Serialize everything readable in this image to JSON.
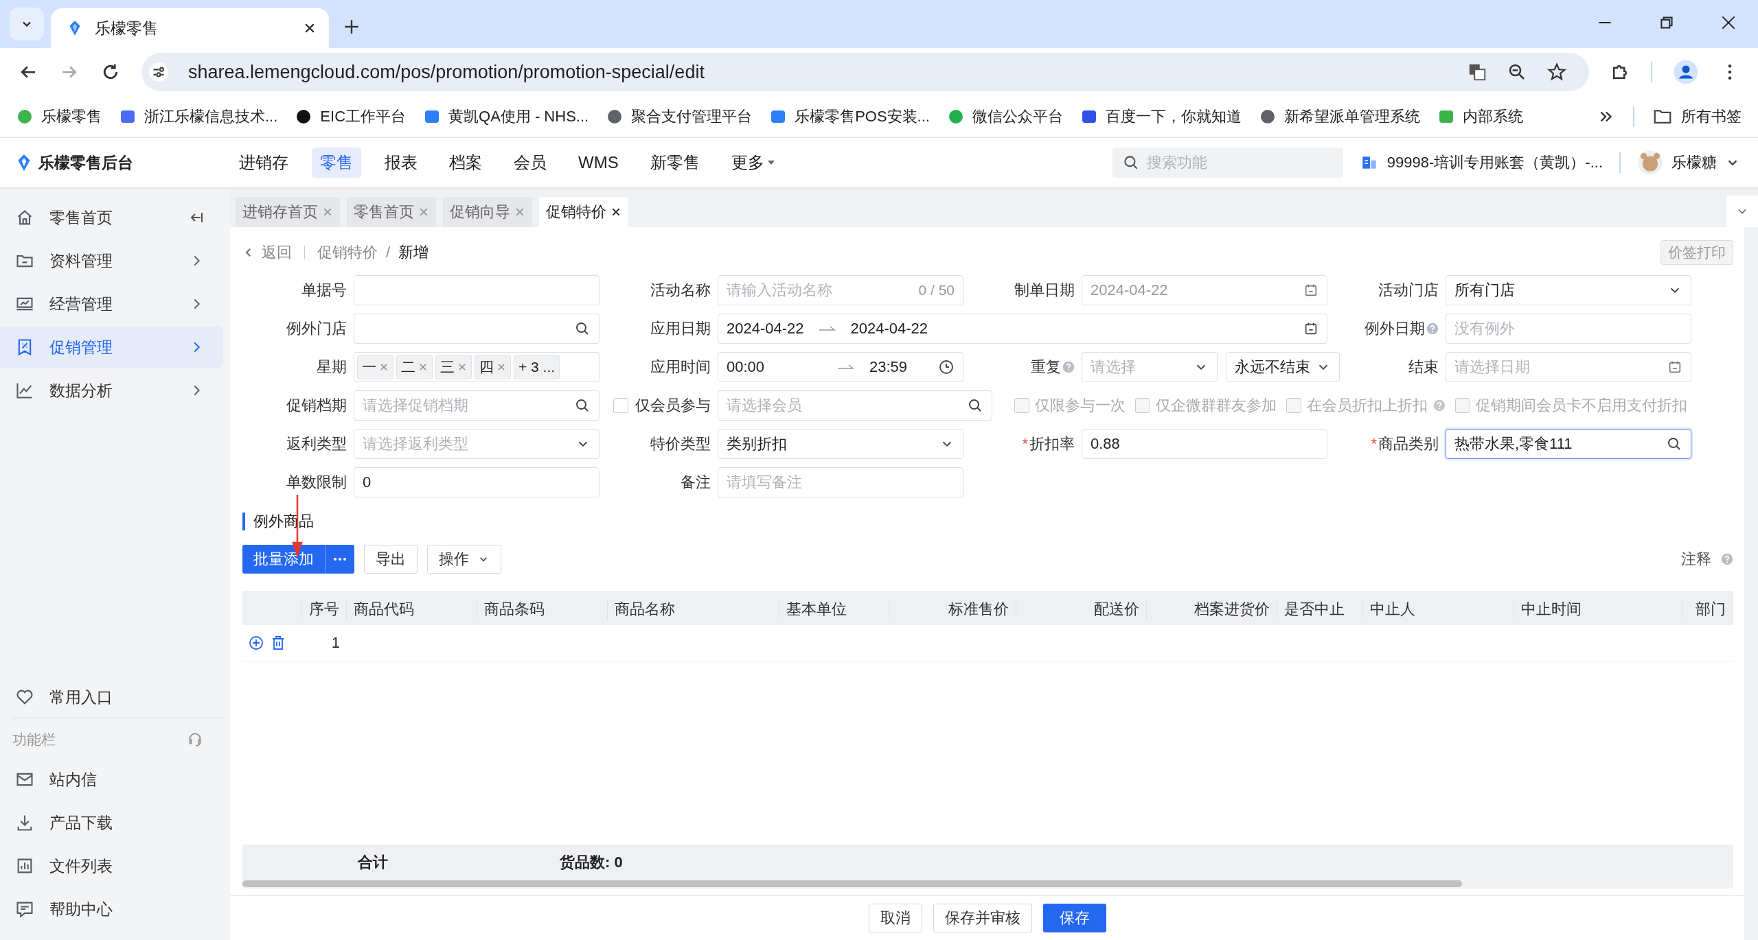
{
  "browser": {
    "tab_title": "乐檬零售",
    "url": "sharea.lemengcloud.com/pos/promotion/promotion-special/edit",
    "bookmarks": [
      "乐檬零售",
      "浙江乐檬信息技术...",
      "EIC工作平台",
      "黄凯QA使用 - NHS...",
      "聚合支付管理平台",
      "乐檬零售POS安装...",
      "微信公众平台",
      "百度一下，你就知道",
      "新希望派单管理系统",
      "内部系统"
    ],
    "all_bookmarks": "所有书签"
  },
  "app": {
    "logo": "乐檬零售后台",
    "nav": [
      {
        "label": "进销存",
        "selected": false,
        "dropdown": false
      },
      {
        "label": "零售",
        "selected": true,
        "dropdown": false
      },
      {
        "label": "报表",
        "selected": false,
        "dropdown": false
      },
      {
        "label": "档案",
        "selected": false,
        "dropdown": false
      },
      {
        "label": "会员",
        "selected": false,
        "dropdown": false
      },
      {
        "label": "WMS",
        "selected": false,
        "dropdown": false
      },
      {
        "label": "新零售",
        "selected": false,
        "dropdown": false
      },
      {
        "label": "更多",
        "selected": false,
        "dropdown": true
      }
    ],
    "search_placeholder": "搜索功能",
    "account": "99998-培训专用账套（黄凯）-...",
    "user": "乐檬糖"
  },
  "sidebar": {
    "items": [
      {
        "label": "零售首页",
        "selected": false,
        "expandable": false
      },
      {
        "label": "资料管理",
        "selected": false,
        "expandable": true
      },
      {
        "label": "经营管理",
        "selected": false,
        "expandable": true
      },
      {
        "label": "促销管理",
        "selected": true,
        "expandable": true
      },
      {
        "label": "数据分析",
        "selected": false,
        "expandable": true
      }
    ],
    "favorites": "常用入口",
    "section": "功能栏",
    "tools": [
      "站内信",
      "产品下载",
      "文件列表",
      "帮助中心"
    ]
  },
  "page_tabs": [
    {
      "label": "进销存首页",
      "selected": false
    },
    {
      "label": "零售首页",
      "selected": false
    },
    {
      "label": "促销向导",
      "selected": false
    },
    {
      "label": "促销特价",
      "selected": true
    }
  ],
  "breadcrumb": {
    "back": "返回",
    "items": [
      "促销特价",
      "新增"
    ],
    "separator": "/"
  },
  "print_button": "价签打印",
  "form": [
    {
      "label": "单据号",
      "kind": "input"
    },
    {
      "label": "活动名称",
      "kind": "input",
      "placeholder": "请输入活动名称",
      "counter": "0 / 50"
    },
    {
      "label": "制单日期",
      "kind": "date",
      "value": "2024-04-22",
      "disabled": true
    },
    {
      "label": "活动门店",
      "kind": "select",
      "value": "所有门店"
    },
    {
      "label": "例外门店",
      "kind": "search"
    },
    {
      "label": "应用日期",
      "kind": "daterange",
      "start": "2024-04-22",
      "end": "2024-04-22"
    },
    {
      "label": "例外日期",
      "kind": "input",
      "placeholder": "没有例外",
      "help": true
    },
    {
      "label": "星期",
      "kind": "tags",
      "tags": [
        "一",
        "二",
        "三",
        "四"
      ],
      "more": "+ 3 ..."
    },
    {
      "label": "应用时间",
      "kind": "timerange",
      "start": "00:00",
      "end": "23:59"
    },
    {
      "label": "重复",
      "kind": "repeat",
      "help": true,
      "placeholder": "请选择",
      "value": "永远不结束"
    },
    {
      "label": "结束",
      "kind": "date",
      "placeholder": "请选择日期"
    },
    {
      "label": "促销档期",
      "kind": "search",
      "placeholder": "请选择促销档期"
    },
    {
      "label": "仅会员参与",
      "kind": "member",
      "checked": false,
      "placeholder": "请选择会员",
      "options": [
        {
          "label": "仅限参与一次",
          "checked": false,
          "disabled": true,
          "help": false
        },
        {
          "label": "仅企微群群友参加",
          "checked": false,
          "disabled": true,
          "help": false
        },
        {
          "label": "在会员折扣上折扣",
          "checked": false,
          "disabled": true,
          "help": true
        },
        {
          "label": "促销期间会员卡不启用支付折扣",
          "checked": false,
          "disabled": true,
          "help": false
        }
      ]
    },
    {
      "label": "返利类型",
      "kind": "select",
      "placeholder": "请选择返利类型"
    },
    {
      "label": "特价类型",
      "kind": "select",
      "value": "类别折扣"
    },
    {
      "label": "折扣率",
      "kind": "input",
      "value": "0.88",
      "required_mark": "*"
    },
    {
      "label": "商品类别",
      "kind": "search",
      "value": "热带水果,零食111",
      "required_mark": "*",
      "focused": true
    },
    {
      "label": "单数限制",
      "kind": "input",
      "value": "0"
    },
    {
      "label": "备注",
      "kind": "input",
      "placeholder": "请填写备注"
    }
  ],
  "section_title": "例外商品",
  "toolbar": {
    "add": "批量添加",
    "export": "导出",
    "actions": "操作",
    "note": "注释"
  },
  "table": {
    "columns": [
      "序号",
      "商品代码",
      "商品条码",
      "商品名称",
      "基本单位",
      "标准售价",
      "配送价",
      "档案进货价",
      "是否中止",
      "中止人",
      "中止时间",
      "部门"
    ],
    "rows": [
      {
        "index": "1"
      }
    ],
    "summary": {
      "label": "合计",
      "count": "货品数: 0"
    }
  },
  "footer": {
    "cancel": "取消",
    "save_review": "保存并审核",
    "save": "保存"
  }
}
